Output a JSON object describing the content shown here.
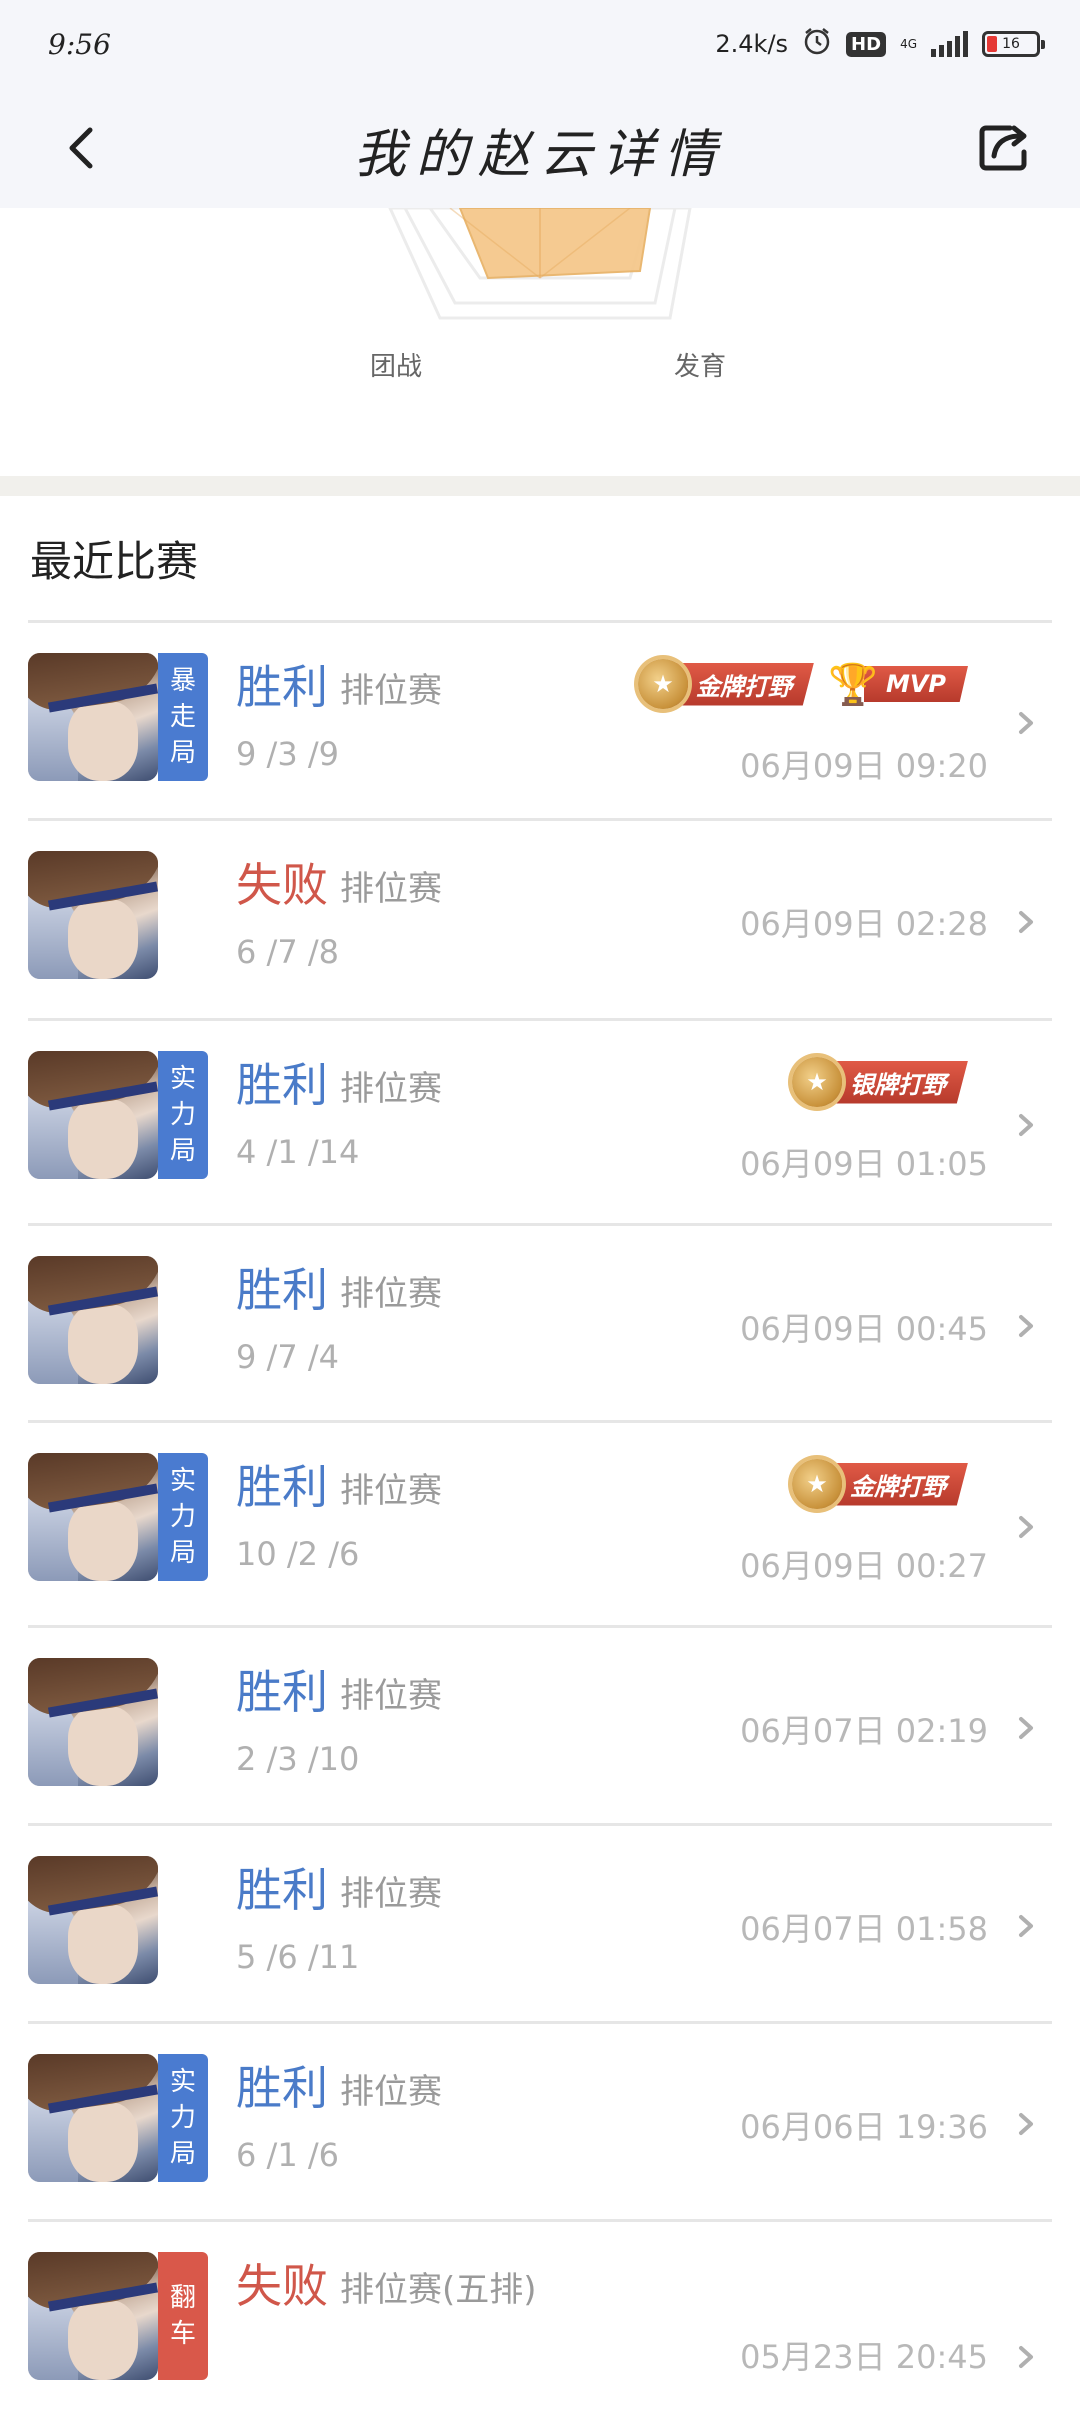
{
  "status_bar": {
    "time": "9:56",
    "network_speed": "2.4k/s",
    "hd": "HD",
    "network_type": "4G",
    "battery": "16"
  },
  "header": {
    "title": "我的赵云详情",
    "back_icon": "chevron-left-icon",
    "share_icon": "share-icon"
  },
  "radar": {
    "labels": {
      "teamfight": "团战",
      "development": "发育"
    },
    "fill_color": "#f5c88c"
  },
  "recent": {
    "title": "最近比赛"
  },
  "colors": {
    "win": "#4a7bc8",
    "loss": "#d0574a",
    "tag_blue": "#4a7bd0",
    "tag_red": "#d9584a"
  },
  "matches": [
    {
      "result": "胜利",
      "outcome": "win",
      "mode": "排位赛",
      "kda": "9 /3 /9",
      "time": "06月09日 09:20",
      "tag": [
        "暴",
        "走",
        "局"
      ],
      "tag_color": "blue",
      "badges": [
        {
          "type": "medal",
          "label": "金牌打野"
        },
        {
          "type": "cup",
          "label": "MVP"
        }
      ]
    },
    {
      "result": "失败",
      "outcome": "loss",
      "mode": "排位赛",
      "kda": "6 /7 /8",
      "time": "06月09日 02:28",
      "tag": [],
      "badges": []
    },
    {
      "result": "胜利",
      "outcome": "win",
      "mode": "排位赛",
      "kda": "4 /1 /14",
      "time": "06月09日 01:05",
      "tag": [
        "实",
        "力",
        "局"
      ],
      "tag_color": "blue",
      "badges": [
        {
          "type": "medal",
          "label": "银牌打野"
        }
      ]
    },
    {
      "result": "胜利",
      "outcome": "win",
      "mode": "排位赛",
      "kda": "9 /7 /4",
      "time": "06月09日 00:45",
      "tag": [],
      "badges": []
    },
    {
      "result": "胜利",
      "outcome": "win",
      "mode": "排位赛",
      "kda": "10 /2 /6",
      "time": "06月09日 00:27",
      "tag": [
        "实",
        "力",
        "局"
      ],
      "tag_color": "blue",
      "badges": [
        {
          "type": "medal",
          "label": "金牌打野"
        }
      ]
    },
    {
      "result": "胜利",
      "outcome": "win",
      "mode": "排位赛",
      "kda": "2 /3 /10",
      "time": "06月07日 02:19",
      "tag": [],
      "badges": []
    },
    {
      "result": "胜利",
      "outcome": "win",
      "mode": "排位赛",
      "kda": "5 /6 /11",
      "time": "06月07日 01:58",
      "tag": [],
      "badges": []
    },
    {
      "result": "胜利",
      "outcome": "win",
      "mode": "排位赛",
      "kda": "6 /1 /6",
      "time": "06月06日 19:36",
      "tag": [
        "实",
        "力",
        "局"
      ],
      "tag_color": "blue",
      "badges": []
    },
    {
      "result": "失败",
      "outcome": "loss",
      "mode": "排位赛(五排)",
      "kda": "",
      "time": "05月23日 20:45",
      "tag": [
        "翻",
        "车"
      ],
      "tag_color": "red",
      "badges": []
    }
  ]
}
